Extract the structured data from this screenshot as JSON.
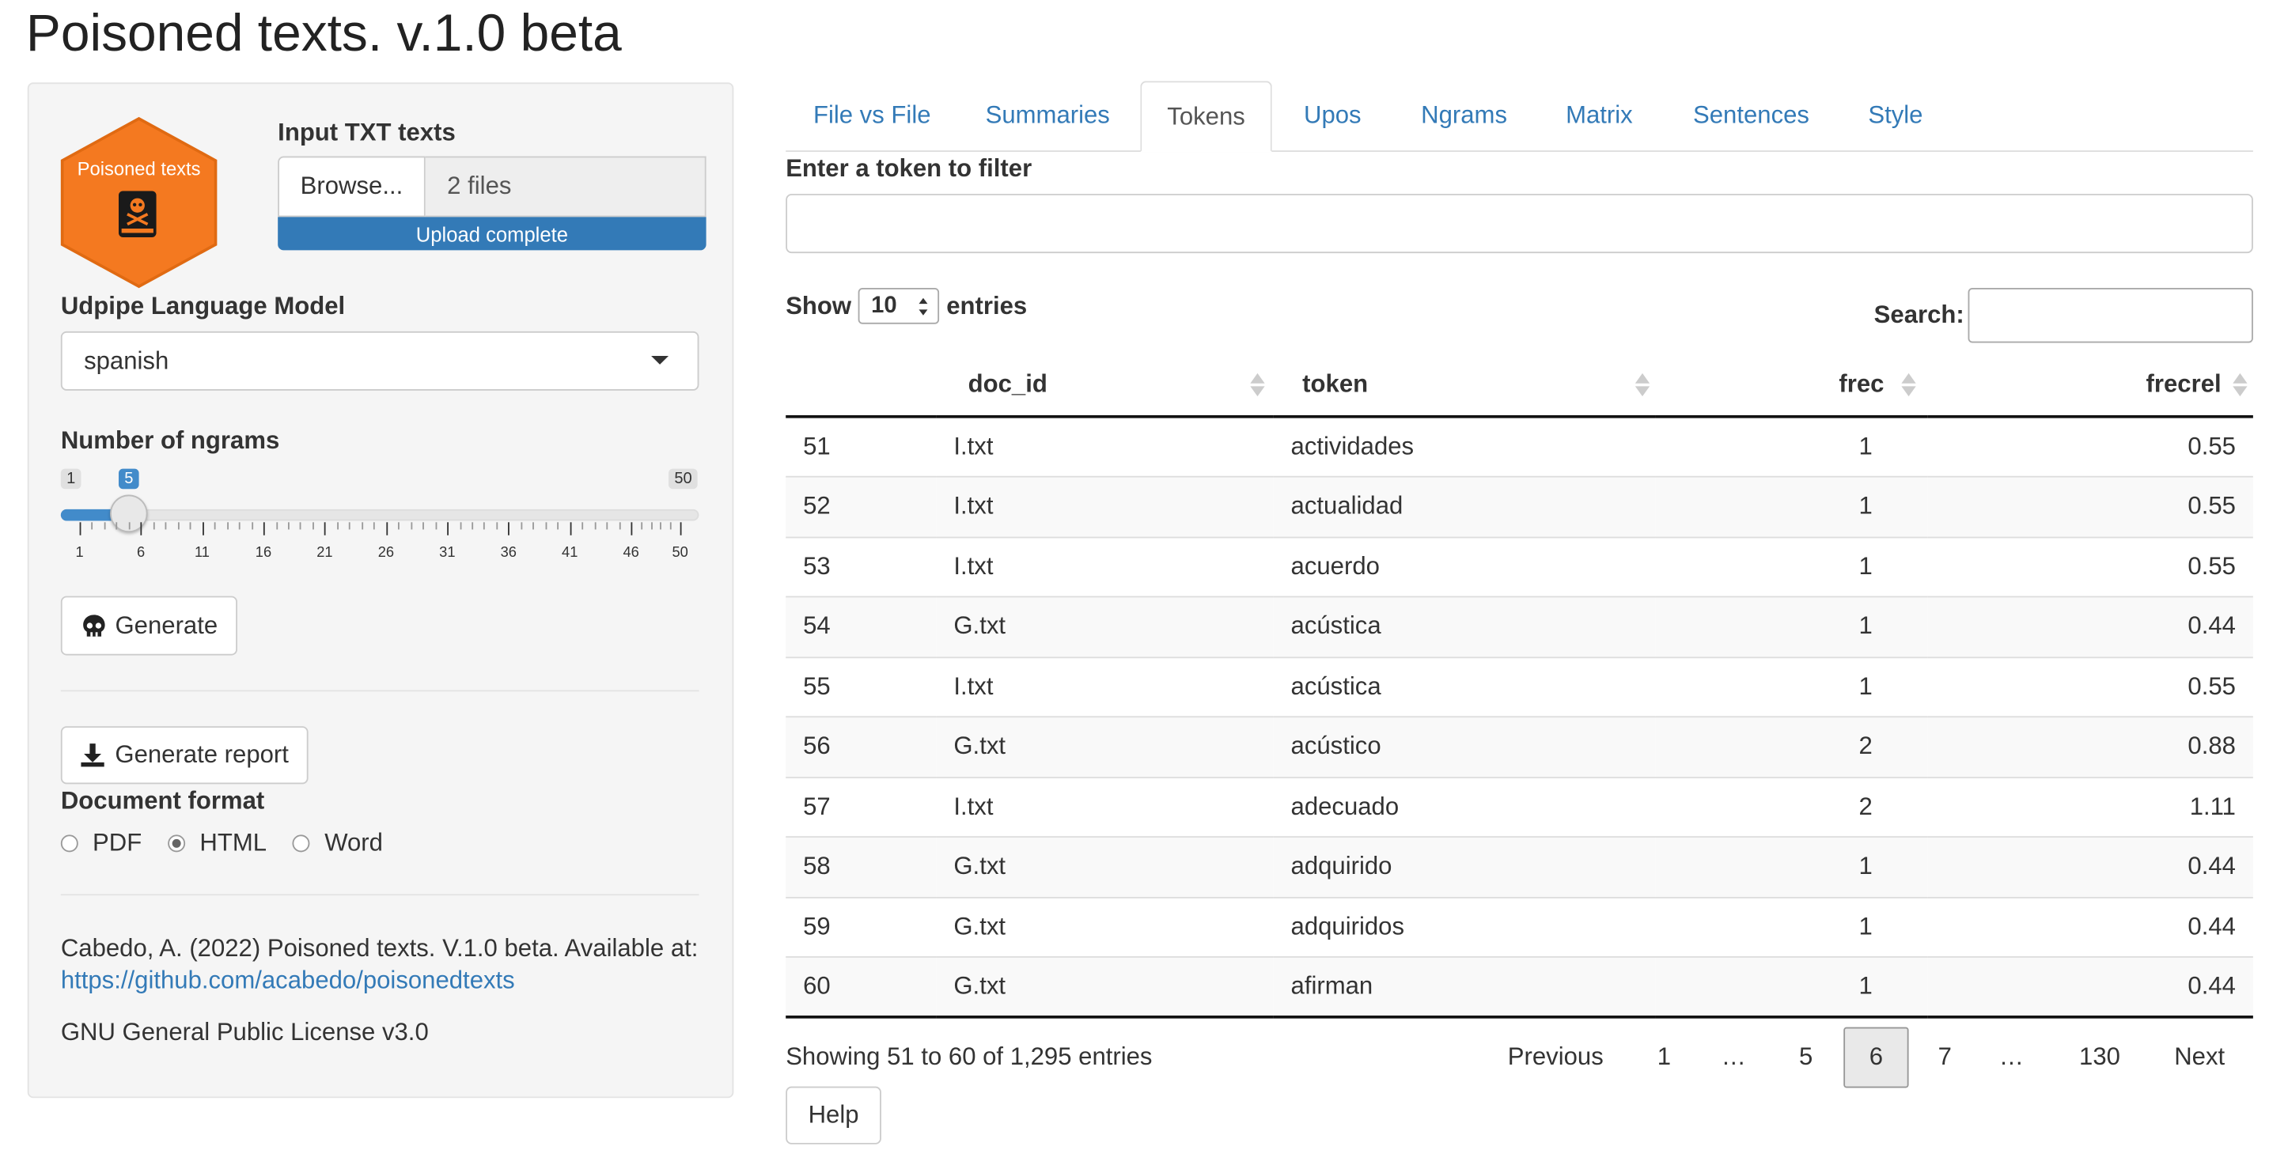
{
  "app": {
    "title": "Poisoned texts. v.1.0 beta"
  },
  "sidebar": {
    "logo_text": "Poisoned texts",
    "upload": {
      "label": "Input TXT texts",
      "browse_label": "Browse...",
      "file_status": "2 files",
      "progress_text": "Upload complete",
      "progress_fraction": 1.0
    },
    "model": {
      "label": "Udpipe Language Model",
      "selected": "spanish"
    },
    "ngrams": {
      "label": "Number of ngrams",
      "min": "1",
      "max": "50",
      "value": "5",
      "tick_labels": [
        "1",
        "6",
        "11",
        "16",
        "21",
        "26",
        "31",
        "36",
        "41",
        "46",
        "50"
      ]
    },
    "generate_label": "Generate",
    "report_label": "Generate report",
    "format": {
      "label": "Document format",
      "options": [
        "PDF",
        "HTML",
        "Word"
      ],
      "selected": "HTML"
    },
    "citation": "Cabedo, A. (2022) Poisoned texts. V.1.0 beta. Available at:",
    "citation_link": "https://github.com/acabedo/poisonedtexts",
    "license": "GNU General Public License v3.0"
  },
  "tabs": [
    {
      "label": "File vs File"
    },
    {
      "label": "Summaries"
    },
    {
      "label": "Tokens",
      "active": true
    },
    {
      "label": "Upos"
    },
    {
      "label": "Ngrams"
    },
    {
      "label": "Matrix"
    },
    {
      "label": "Sentences"
    },
    {
      "label": "Style"
    }
  ],
  "main": {
    "filter_label": "Enter a token to filter",
    "filter_value": "",
    "show_label": "Show",
    "entries_value": "10",
    "entries_label": "entries",
    "search_label": "Search:",
    "search_value": "",
    "table": {
      "columns": [
        "",
        "doc_id",
        "token",
        "frec",
        "frecrel"
      ],
      "rows": [
        [
          "51",
          "I.txt",
          "actividades",
          "1",
          "0.55"
        ],
        [
          "52",
          "I.txt",
          "actualidad",
          "1",
          "0.55"
        ],
        [
          "53",
          "I.txt",
          "acuerdo",
          "1",
          "0.55"
        ],
        [
          "54",
          "G.txt",
          "acústica",
          "1",
          "0.44"
        ],
        [
          "55",
          "I.txt",
          "acústica",
          "1",
          "0.55"
        ],
        [
          "56",
          "G.txt",
          "acústico",
          "2",
          "0.88"
        ],
        [
          "57",
          "I.txt",
          "adecuado",
          "2",
          "1.11"
        ],
        [
          "58",
          "G.txt",
          "adquirido",
          "1",
          "0.44"
        ],
        [
          "59",
          "G.txt",
          "adquiridos",
          "1",
          "0.44"
        ],
        [
          "60",
          "G.txt",
          "afirman",
          "1",
          "0.44"
        ]
      ]
    },
    "info": "Showing 51 to 60 of 1,295 entries",
    "pagination": {
      "previous": "Previous",
      "pages": [
        "1",
        "…",
        "5",
        "6",
        "7",
        "…",
        "130"
      ],
      "current": "6",
      "next": "Next"
    },
    "help_label": "Help"
  },
  "colors": {
    "accent": "#337ab7",
    "logo_orange": "#f47920",
    "sidebar_bg": "#f5f5f5"
  }
}
